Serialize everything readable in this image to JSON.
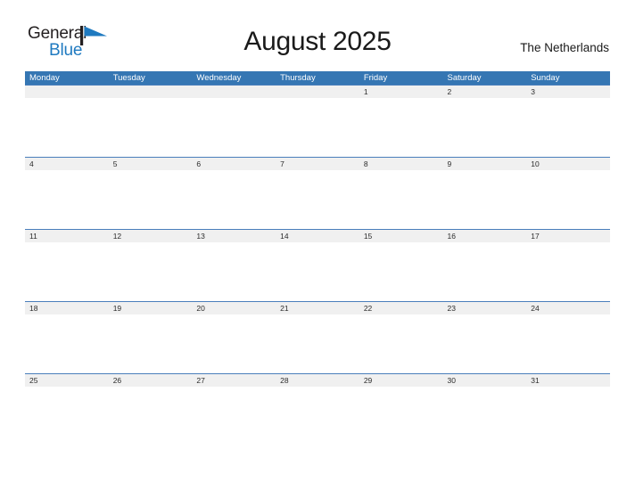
{
  "brand": {
    "name_part1": "General",
    "name_part2": "Blue",
    "mark_icon": "flag-triangle-icon",
    "color_primary": "#1f7ac0",
    "color_text": "#231f20"
  },
  "header": {
    "title": "August 2025",
    "subtitle": "The Netherlands"
  },
  "theme": {
    "header_blue": "#3576b3",
    "date_band_gray": "#f0f0f0",
    "separator_blue": "#4a7ebb",
    "text_dark": "#2b2b2b",
    "background": "#ffffff"
  },
  "calendar": {
    "month": "August",
    "year": "2025",
    "weekday_headers": [
      "Monday",
      "Tuesday",
      "Wednesday",
      "Thursday",
      "Friday",
      "Saturday",
      "Sunday"
    ],
    "weeks": [
      {
        "days": [
          "",
          "",
          "",
          "",
          "1",
          "2",
          "3"
        ]
      },
      {
        "days": [
          "4",
          "5",
          "6",
          "7",
          "8",
          "9",
          "10"
        ]
      },
      {
        "days": [
          "11",
          "12",
          "13",
          "14",
          "15",
          "16",
          "17"
        ]
      },
      {
        "days": [
          "18",
          "19",
          "20",
          "21",
          "22",
          "23",
          "24"
        ]
      },
      {
        "days": [
          "25",
          "26",
          "27",
          "28",
          "29",
          "30",
          "31"
        ]
      }
    ]
  }
}
